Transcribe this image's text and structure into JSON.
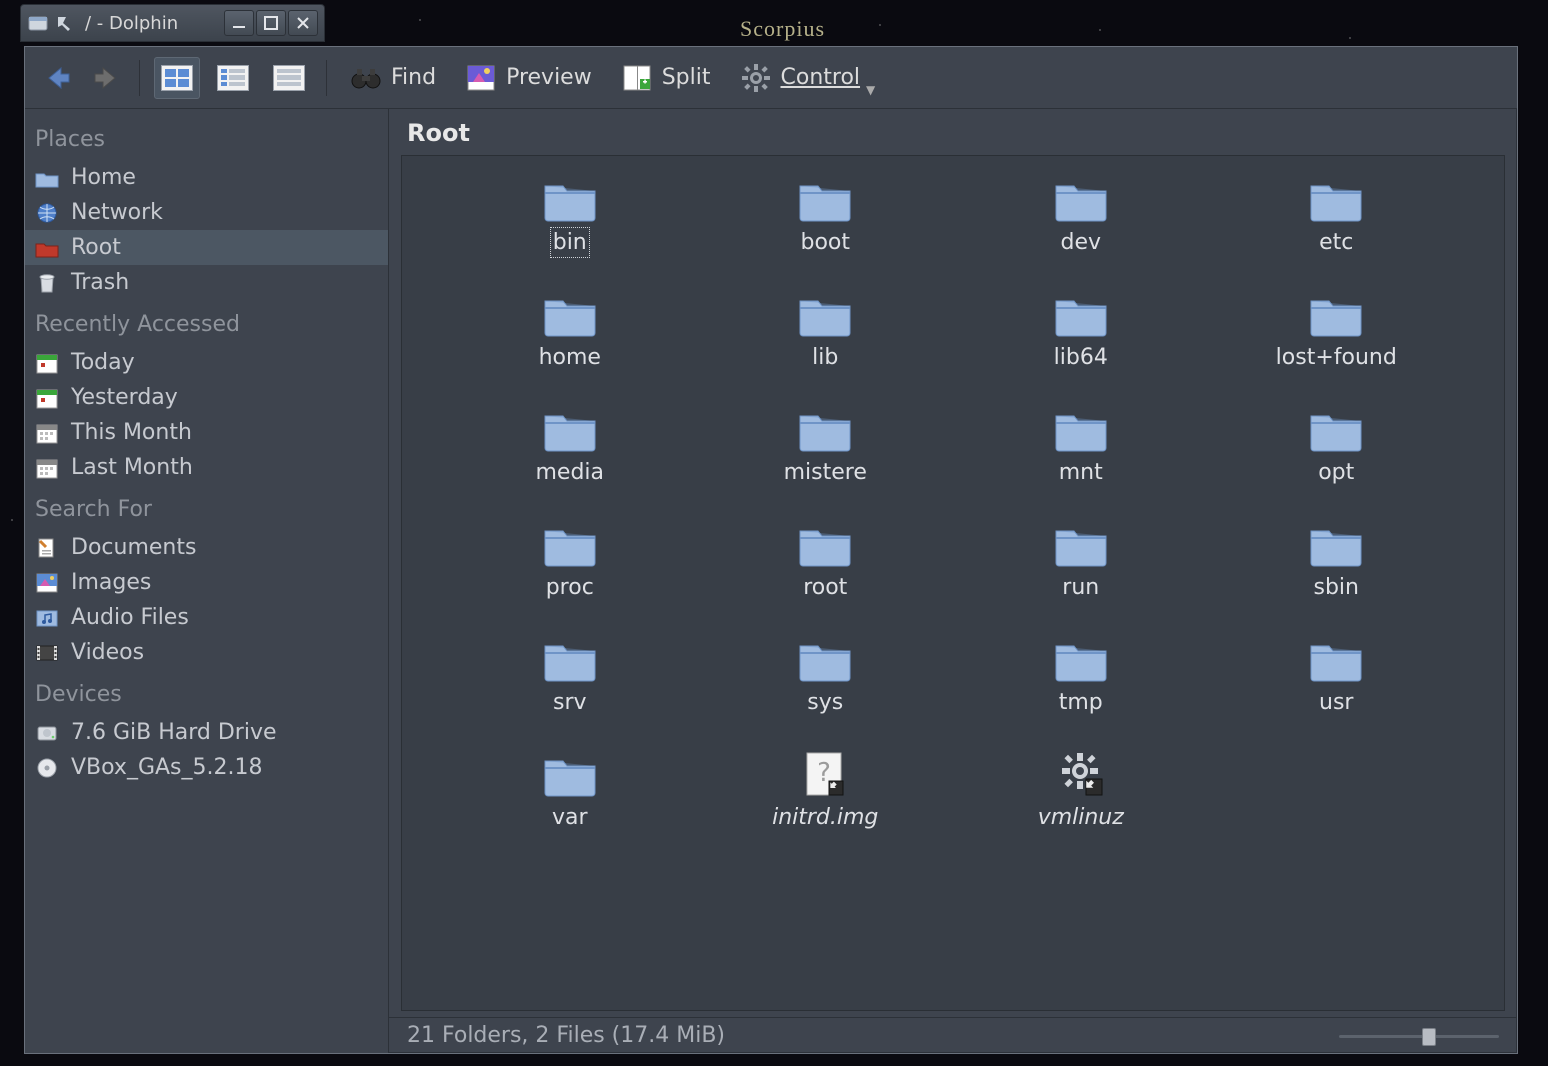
{
  "desktop": {
    "constellation": "Scorpius"
  },
  "window": {
    "title": "/ - Dolphin",
    "location_label": "Root"
  },
  "toolbar": {
    "find": "Find",
    "preview": "Preview",
    "split": "Split",
    "control": "Control"
  },
  "sidebar": {
    "sections": [
      {
        "title": "Places",
        "items": [
          {
            "icon": "home-folder",
            "label": "Home",
            "selected": false
          },
          {
            "icon": "network-globe",
            "label": "Network",
            "selected": false
          },
          {
            "icon": "root-folder",
            "label": "Root",
            "selected": true
          },
          {
            "icon": "trash",
            "label": "Trash",
            "selected": false
          }
        ]
      },
      {
        "title": "Recently Accessed",
        "items": [
          {
            "icon": "calendar-day",
            "label": "Today"
          },
          {
            "icon": "calendar-day",
            "label": "Yesterday"
          },
          {
            "icon": "calendar-month",
            "label": "This Month"
          },
          {
            "icon": "calendar-month",
            "label": "Last Month"
          }
        ]
      },
      {
        "title": "Search For",
        "items": [
          {
            "icon": "documents",
            "label": "Documents"
          },
          {
            "icon": "images",
            "label": "Images"
          },
          {
            "icon": "audio",
            "label": "Audio Files"
          },
          {
            "icon": "videos",
            "label": "Videos"
          }
        ]
      },
      {
        "title": "Devices",
        "items": [
          {
            "icon": "harddrive",
            "label": "7.6 GiB Hard Drive"
          },
          {
            "icon": "optical",
            "label": "VBox_GAs_5.2.18"
          }
        ]
      }
    ]
  },
  "files": {
    "items": [
      {
        "name": "bin",
        "type": "folder",
        "selected": true
      },
      {
        "name": "boot",
        "type": "folder"
      },
      {
        "name": "dev",
        "type": "folder"
      },
      {
        "name": "etc",
        "type": "folder"
      },
      {
        "name": "home",
        "type": "folder"
      },
      {
        "name": "lib",
        "type": "folder"
      },
      {
        "name": "lib64",
        "type": "folder"
      },
      {
        "name": "lost+found",
        "type": "folder"
      },
      {
        "name": "media",
        "type": "folder"
      },
      {
        "name": "mistere",
        "type": "folder"
      },
      {
        "name": "mnt",
        "type": "folder"
      },
      {
        "name": "opt",
        "type": "folder"
      },
      {
        "name": "proc",
        "type": "folder"
      },
      {
        "name": "root",
        "type": "folder"
      },
      {
        "name": "run",
        "type": "folder"
      },
      {
        "name": "sbin",
        "type": "folder"
      },
      {
        "name": "srv",
        "type": "folder"
      },
      {
        "name": "sys",
        "type": "folder"
      },
      {
        "name": "tmp",
        "type": "folder"
      },
      {
        "name": "usr",
        "type": "folder"
      },
      {
        "name": "var",
        "type": "folder"
      },
      {
        "name": "initrd.img",
        "type": "file-link",
        "italic": true
      },
      {
        "name": "vmlinuz",
        "type": "exec-link",
        "italic": true
      }
    ]
  },
  "status": {
    "text": "21 Folders, 2 Files (17.4 MiB)"
  },
  "colors": {
    "folder_light": "#9fbbe0",
    "folder_dark": "#6f94c7",
    "accent_red": "#c0392b"
  }
}
